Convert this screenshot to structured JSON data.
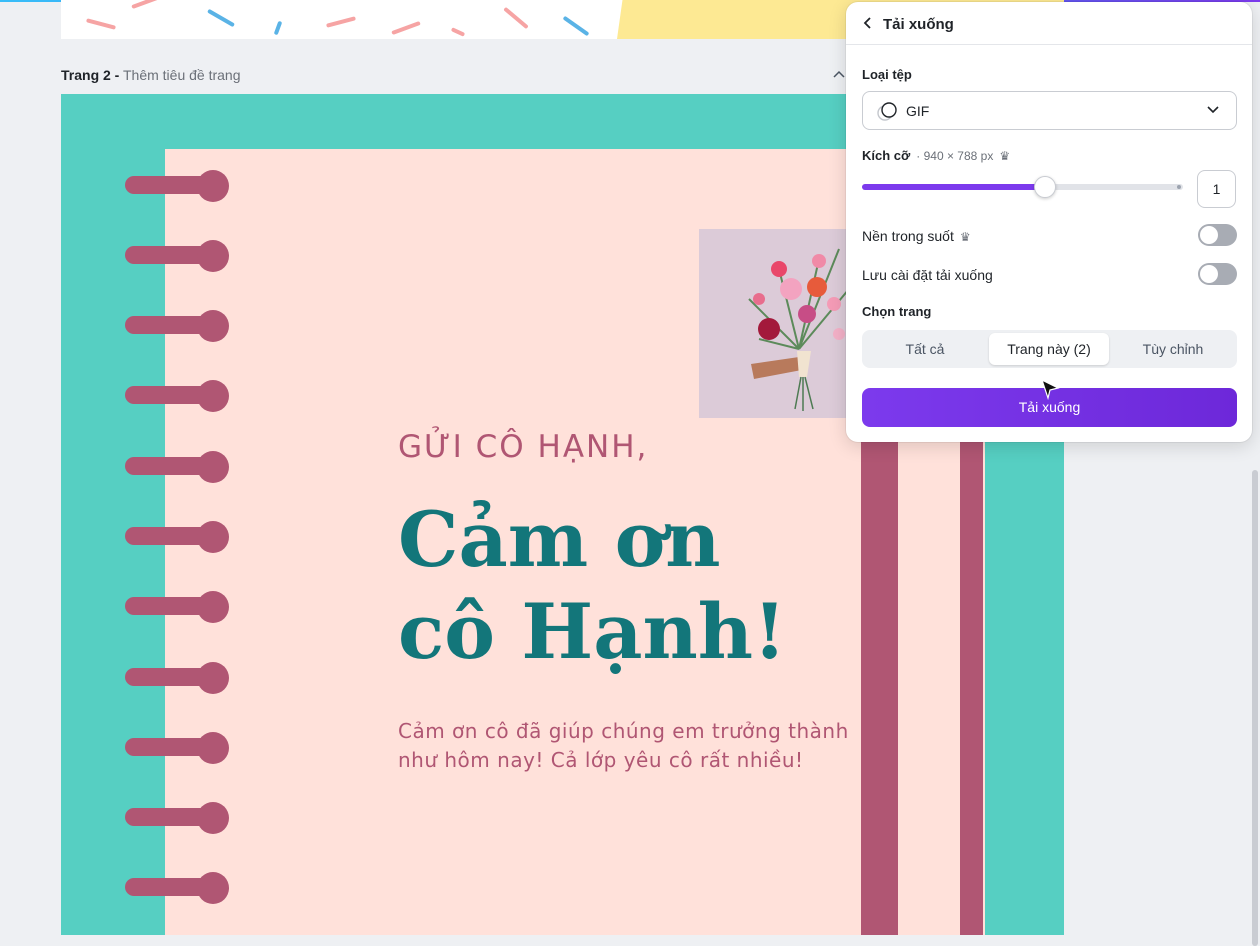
{
  "page": {
    "label_bold": "Trang 2 -",
    "label_sub": " Thêm tiêu đề trang"
  },
  "design": {
    "greeting": "GỬI CÔ HẠNH,",
    "headline_line1": "Cảm ơn",
    "headline_line2": "cô Hạnh!",
    "body_line1": "Cảm ơn cô đã giúp chúng em trưởng thành",
    "body_line2": "như hôm nay! Cả lớp yêu cô rất nhiều!"
  },
  "download_panel": {
    "title": "Tải xuống",
    "file_type_label": "Loại tệp",
    "file_type_value": "GIF",
    "size_label": "Kích cỡ",
    "size_value": "· 940 × 788 px",
    "size_multiplier": "1",
    "slider_fraction": 0.57,
    "transparent_bg_label": "Nền trong suốt",
    "save_settings_label": "Lưu cài đặt tải xuống",
    "transparent_bg_on": false,
    "save_settings_on": false,
    "choose_page_label": "Chọn trang",
    "page_options": [
      "Tất cả",
      "Trang này (2)",
      "Tùy chỉnh"
    ],
    "page_option_selected": "Trang này (2)",
    "download_button": "Tải xuống"
  },
  "colors": {
    "canvas_teal": "#56cfc2",
    "paper_pink": "#ffe1da",
    "accent_rose": "#b05673",
    "headline_teal": "#13767a",
    "brand_purple": "#7c3aed"
  },
  "icons": {
    "back": "chevron-left-icon",
    "collapse": "chevron-up-icon",
    "file_type": "gif-icon",
    "dropdown": "chevron-down-icon",
    "premium": "crown-icon"
  }
}
